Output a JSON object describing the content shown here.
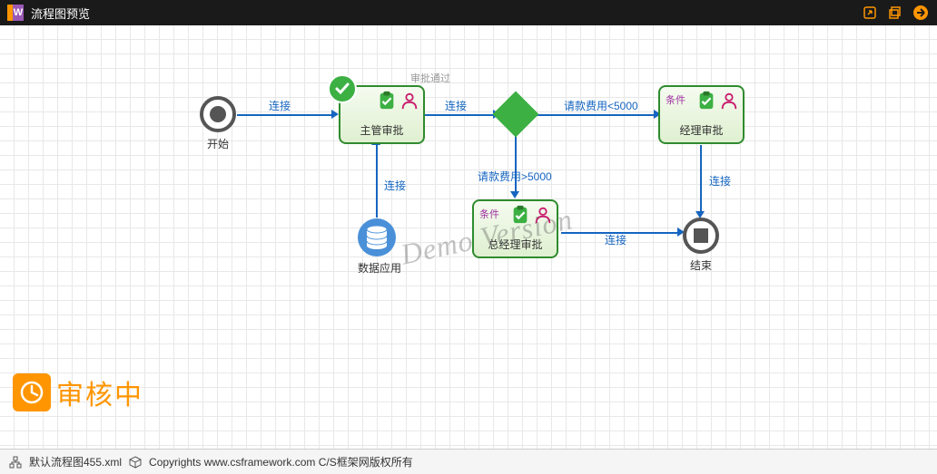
{
  "window": {
    "title": "流程图预览"
  },
  "nodes": {
    "start": {
      "label": "开始"
    },
    "sup_approve": {
      "label": "主管审批",
      "approved": "审批通过"
    },
    "mgr_approve": {
      "label": "经理审批",
      "cond": "条件"
    },
    "gm_approve": {
      "label": "总经理审批",
      "cond": "条件"
    },
    "data_app": {
      "label": "数据应用"
    },
    "end": {
      "label": "结束"
    }
  },
  "edges": {
    "e1": "连接",
    "e2": "连接",
    "e3": "请款费用<5000",
    "e4": "请款费用>5000",
    "e5": "连接",
    "e6": "连接",
    "e7": "连接"
  },
  "watermark": "Demo Version",
  "stamp": "审核中",
  "status": {
    "file": "默认流程图455.xml",
    "copyright": "Copyrights www.csframework.com C/S框架网版权所有"
  }
}
